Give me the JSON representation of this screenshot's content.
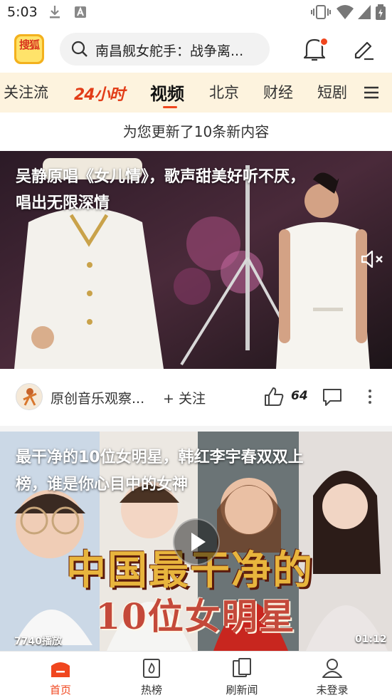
{
  "status_bar": {
    "time": "5:03"
  },
  "header": {
    "logo_text": "搜狐",
    "search_text": "南昌舰女舵手：战争离..."
  },
  "tabs": {
    "items": [
      "关注流",
      "视频",
      "北京",
      "财经",
      "短剧"
    ],
    "brand_tab": "24小时",
    "active": "视频"
  },
  "refresh_note": "为您更新了10条新内容",
  "card1": {
    "title_line1": "吴静原唱《女儿情》，歌声甜美好听不厌，",
    "title_line2": "唱出无限深情",
    "author": "原创音乐观察...",
    "follow": "+ 关注",
    "likes": "64"
  },
  "card2": {
    "title_line1": "最干净的10位女明星，韩红李宇春双双上",
    "title_line2": "榜，谁是你心目中的女神",
    "thumb_line1": "中国最干净的",
    "thumb_line2": "10位女明星",
    "play_count": "7740播放",
    "duration": "01:12"
  },
  "bottom_nav": [
    {
      "label": "首页",
      "icon": "home-icon"
    },
    {
      "label": "热榜",
      "icon": "hot-list-icon"
    },
    {
      "label": "刷新闻",
      "icon": "news-feed-icon"
    },
    {
      "label": "未登录",
      "icon": "user-icon"
    }
  ],
  "colors": {
    "accent": "#f0461e",
    "tab_bg": "#fdf3de"
  }
}
